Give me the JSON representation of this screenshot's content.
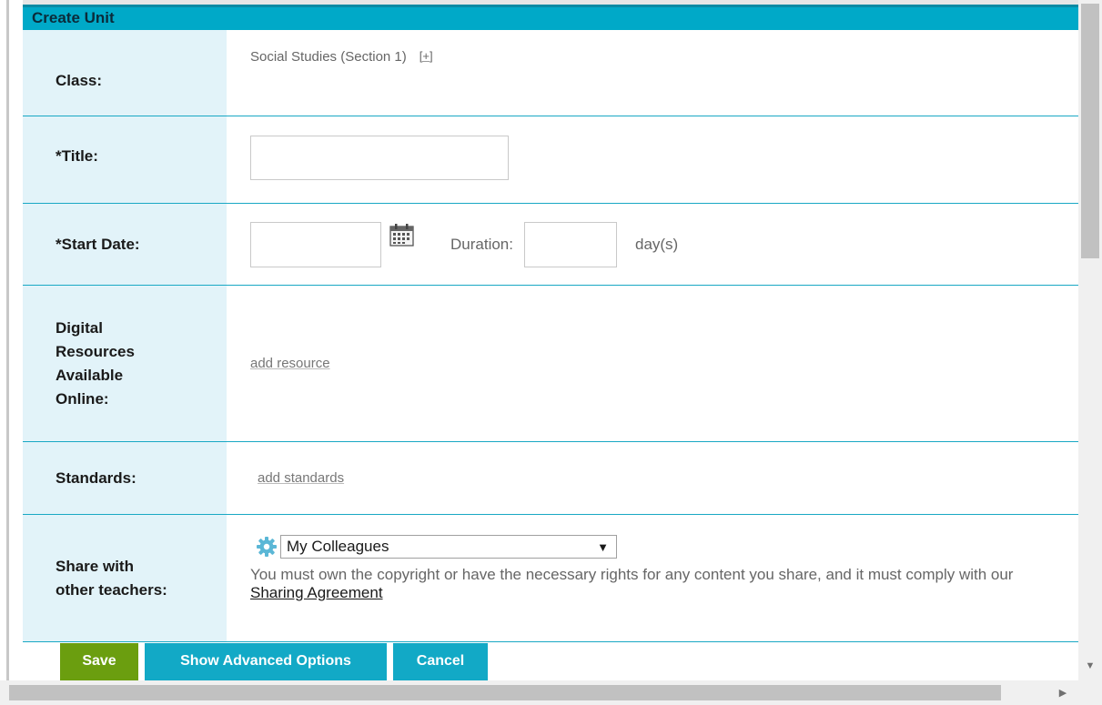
{
  "dialog": {
    "title": "Create Unit"
  },
  "fields": {
    "class": {
      "label": "Class:",
      "value": "Social Studies (Section 1)",
      "add": "[+]"
    },
    "title": {
      "label": "*Title:",
      "value": ""
    },
    "start_date": {
      "label": "*Start Date:",
      "value": "",
      "duration_label": "Duration:",
      "duration_value": "",
      "duration_unit": "day(s)"
    },
    "resources": {
      "label": "Digital Resources Available Online:",
      "link": "add resource"
    },
    "standards": {
      "label": "Standards:",
      "link": "add standards"
    },
    "share": {
      "label": "Share with other teachers:",
      "selected": "My Colleagues",
      "note": "You must own the copyright or have the necessary rights for any content you share, and it must comply with our",
      "agreement_link": "Sharing Agreement"
    }
  },
  "buttons": {
    "save": "Save",
    "advanced": "Show Advanced Options",
    "cancel": "Cancel"
  },
  "colors": {
    "header": "#00a9c8",
    "label_bg": "#e2f3f9",
    "save": "#6b9e0f",
    "action": "#12a9c6"
  },
  "icons": [
    "calendar-icon",
    "gear-icon",
    "chevron-down-icon"
  ]
}
